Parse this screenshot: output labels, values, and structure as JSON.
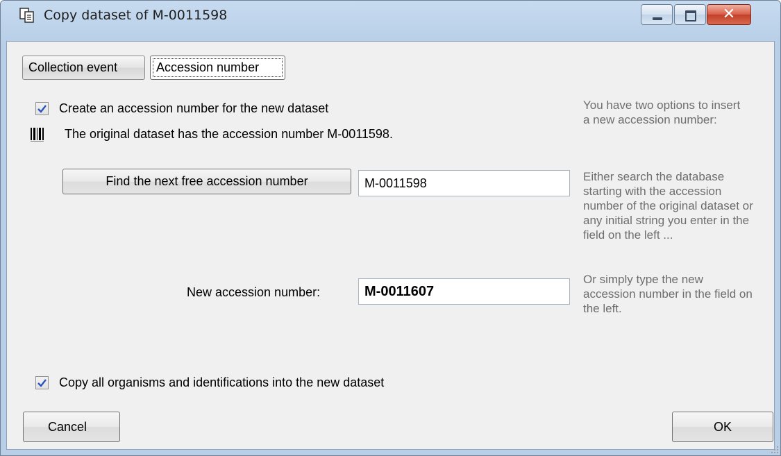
{
  "window": {
    "title": "Copy dataset of M-0011598",
    "icon": "copy-document-icon",
    "controls": {
      "minimize": "minimize-icon",
      "maximize": "maximize-icon",
      "close": "✕"
    }
  },
  "tabs": [
    {
      "label": "Collection event",
      "active": false
    },
    {
      "label": "Accession number",
      "active": true
    }
  ],
  "create_accession": {
    "checked": true,
    "label": "Create an accession number for the new dataset"
  },
  "original_info": {
    "icon": "barcode-icon",
    "text": "The original dataset has the accession number M-0011598."
  },
  "find_button": {
    "label": "Find the next free accession number"
  },
  "search_field": {
    "value": "M-0011598"
  },
  "new_accession": {
    "label": "New accession number:",
    "value": "M-0011607"
  },
  "hints": {
    "options": "You have two options to insert a new accession number:",
    "search": "Either search the database starting with the accession number of the original dataset or any initial string you enter in the field on the left ...",
    "type": "Or simply type the new accession number in the field on the left."
  },
  "copy_organisms": {
    "checked": true,
    "label": "Copy all organisms and identifications into the new dataset"
  },
  "buttons": {
    "cancel": "Cancel",
    "ok": "OK"
  },
  "colors": {
    "titlebar": "#bdd3ea",
    "client": "#f0f0f0",
    "hint_text": "#6d6d6d",
    "close_button": "#c3402a"
  }
}
